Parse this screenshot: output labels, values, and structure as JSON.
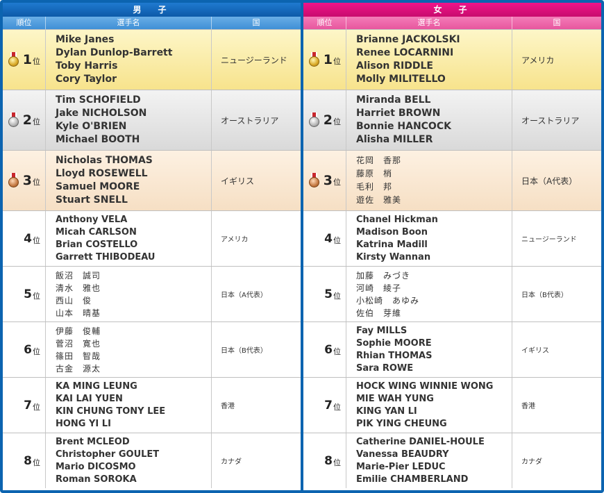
{
  "men": {
    "title": "男　子",
    "headers": {
      "rank": "順位",
      "name": "選手名",
      "country": "国"
    },
    "rows": [
      {
        "rank": "1",
        "suffix": "位",
        "medal": "gold-medal-icon",
        "names": [
          "Mike Janes",
          "Dylan Dunlop-Barrett",
          "Toby Harris",
          "Cory Taylor"
        ],
        "country": "ニュージーランド"
      },
      {
        "rank": "2",
        "suffix": "位",
        "medal": "silver-medal-icon",
        "names": [
          "Tim SCHOFIELD",
          "Jake NICHOLSON",
          "Kyle O'BRIEN",
          "Michael BOOTH"
        ],
        "country": "オーストラリア"
      },
      {
        "rank": "3",
        "suffix": "位",
        "medal": "bronze-medal-icon",
        "names": [
          "Nicholas THOMAS",
          "Lloyd ROSEWELL",
          "Samuel MOORE",
          "Stuart SNELL"
        ],
        "country": "イギリス"
      },
      {
        "rank": "4",
        "suffix": "位",
        "names": [
          "Anthony VELA",
          "Micah CARLSON",
          "Brian COSTELLO",
          "Garrett THIBODEAU"
        ],
        "country": "アメリカ"
      },
      {
        "rank": "5",
        "suffix": "位",
        "names": [
          "飯沼　誠司",
          "清水　雅也",
          "西山　俊",
          "山本　晴基"
        ],
        "country": "日本（A代表）",
        "jp": true
      },
      {
        "rank": "6",
        "suffix": "位",
        "names": [
          "伊藤　俊輔",
          "菅沼　寛也",
          "篠田　智哉",
          "古金　源太"
        ],
        "country": "日本（B代表）",
        "jp": true
      },
      {
        "rank": "7",
        "suffix": "位",
        "names": [
          "KA MING LEUNG",
          "KAI LAI YUEN",
          "KIN CHUNG TONY LEE",
          "HONG YI LI"
        ],
        "country": "香港"
      },
      {
        "rank": "8",
        "suffix": "位",
        "names": [
          "Brent MCLEOD",
          "Christopher GOULET",
          "Mario DICOSMO",
          "Roman SOROKA"
        ],
        "country": "カナダ"
      }
    ]
  },
  "women": {
    "title": "女　子",
    "headers": {
      "rank": "順位",
      "name": "選手名",
      "country": "国"
    },
    "rows": [
      {
        "rank": "1",
        "suffix": "位",
        "medal": "gold-medal-icon",
        "names": [
          "Brianne JACKOLSKI",
          "Renee LOCARNINI",
          "Alison RIDDLE",
          "Molly MILITELLO"
        ],
        "country": "アメリカ"
      },
      {
        "rank": "2",
        "suffix": "位",
        "medal": "silver-medal-icon",
        "names": [
          "Miranda BELL",
          "Harriet BROWN",
          "Bonnie HANCOCK",
          "Alisha MILLER"
        ],
        "country": "オーストラリア"
      },
      {
        "rank": "3",
        "suffix": "位",
        "medal": "bronze-medal-icon",
        "names": [
          "花岡　香那",
          "藤原　梢",
          "毛利　邦",
          "遊佐　雅美"
        ],
        "country": "日本（A代表）",
        "jp": true
      },
      {
        "rank": "4",
        "suffix": "位",
        "names": [
          "Chanel Hickman",
          "Madison Boon",
          "Katrina Madill",
          "Kirsty Wannan"
        ],
        "country": "ニュージーランド"
      },
      {
        "rank": "5",
        "suffix": "位",
        "names": [
          "加藤　みづき",
          "河崎　綾子",
          "小松崎　あゆみ",
          "佐伯　芽維"
        ],
        "country": "日本（B代表）",
        "jp": true
      },
      {
        "rank": "6",
        "suffix": "位",
        "names": [
          "Fay MILLS",
          "Sophie MOORE",
          "Rhian THOMAS",
          "Sara ROWE"
        ],
        "country": "イギリス"
      },
      {
        "rank": "7",
        "suffix": "位",
        "names": [
          "HOCK WING WINNIE WONG",
          "MIE WAH YUNG",
          "KING YAN LI",
          "PIK YING CHEUNG"
        ],
        "country": "香港"
      },
      {
        "rank": "8",
        "suffix": "位",
        "names": [
          "Catherine DANIEL-HOULE",
          "Vanessa BEAUDRY",
          "Marie-Pier LEDUC",
          "Emilie CHAMBERLAND"
        ],
        "country": "カナダ"
      }
    ]
  }
}
